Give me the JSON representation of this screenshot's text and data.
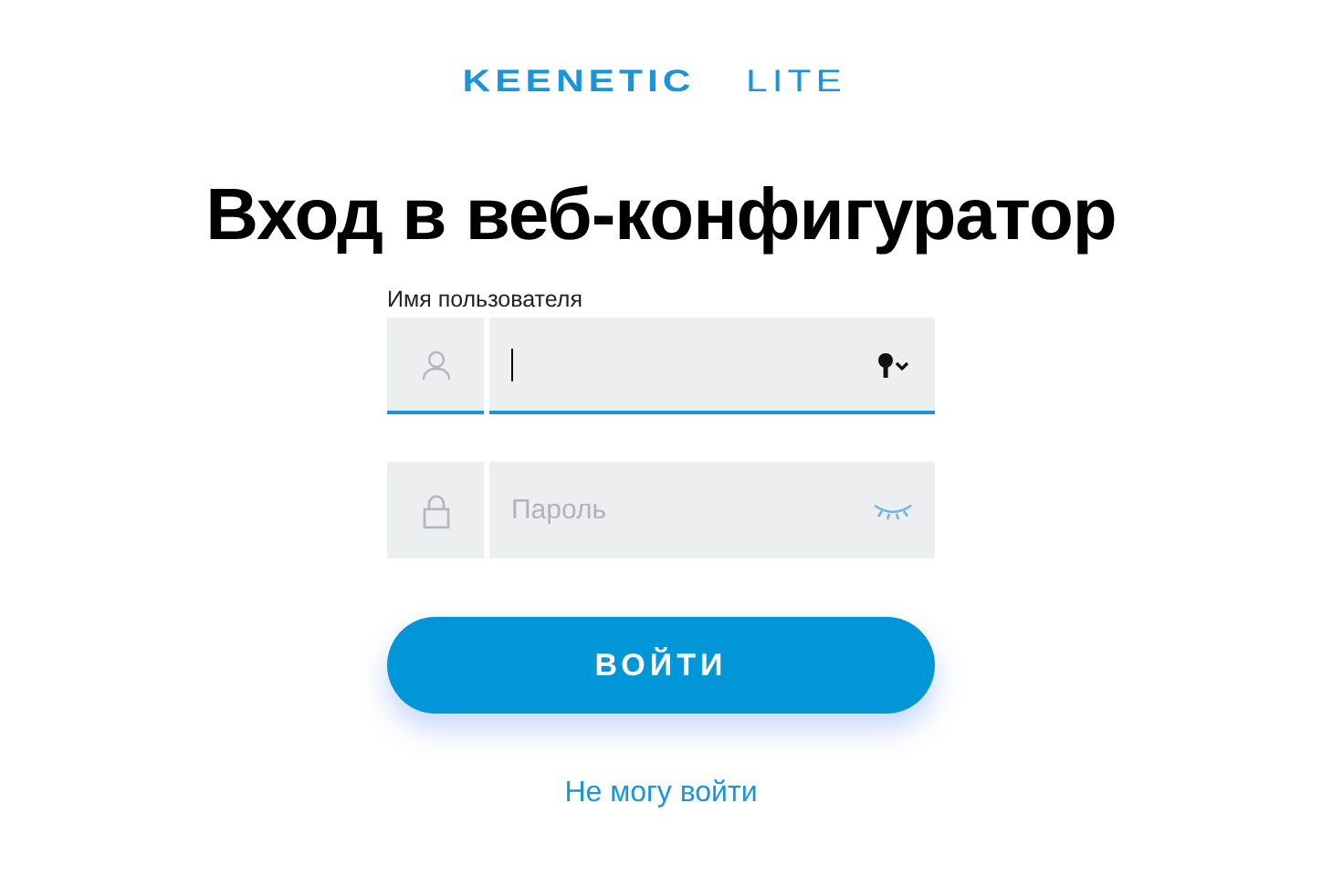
{
  "logo": {
    "brand": "KEENETIC",
    "model": "LITE"
  },
  "title": "Вход в веб-конфигуратор",
  "fields": [
    {
      "kind": "username",
      "label": "Имя пользователя",
      "focused": true
    },
    {
      "kind": "password",
      "placeholder": "Пароль",
      "focused": false
    }
  ],
  "submit": "ВОЙТИ",
  "help_link": "Не могу войти"
}
